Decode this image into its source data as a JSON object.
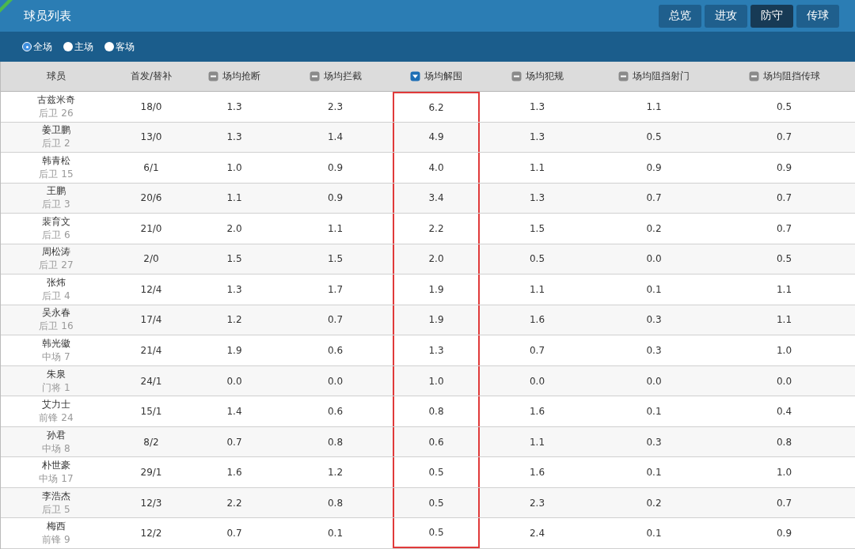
{
  "header": {
    "title": "球员列表",
    "tabs": [
      {
        "label": "总览",
        "selected": false
      },
      {
        "label": "进攻",
        "selected": false
      },
      {
        "label": "防守",
        "selected": true
      },
      {
        "label": "传球",
        "selected": false
      }
    ]
  },
  "filters": [
    {
      "label": "全场",
      "selected": true
    },
    {
      "label": "主场",
      "selected": false
    },
    {
      "label": "客场",
      "selected": false
    }
  ],
  "table": {
    "columns": [
      {
        "label": "球员",
        "kind": "plain",
        "highlighted": false
      },
      {
        "label": "首发/替补",
        "kind": "plain",
        "highlighted": false
      },
      {
        "label": "场均抢断",
        "kind": "sortable",
        "sorted": false,
        "highlighted": false
      },
      {
        "label": "场均拦截",
        "kind": "sortable",
        "sorted": false,
        "highlighted": false
      },
      {
        "label": "场均解围",
        "kind": "sortable",
        "sorted": true,
        "highlighted": true
      },
      {
        "label": "场均犯规",
        "kind": "sortable",
        "sorted": false,
        "highlighted": false
      },
      {
        "label": "场均阻挡射门",
        "kind": "sortable",
        "sorted": false,
        "highlighted": false
      },
      {
        "label": "场均阻挡传球",
        "kind": "sortable",
        "sorted": false,
        "highlighted": false
      }
    ],
    "rows": [
      {
        "cells": [
          "古兹米奇",
          "18/0",
          "1.3",
          "2.3",
          "6.2",
          "1.3",
          "1.1",
          "0.5"
        ],
        "position": "后卫 26"
      },
      {
        "cells": [
          "姜卫鹏",
          "13/0",
          "1.3",
          "1.4",
          "4.9",
          "1.3",
          "0.5",
          "0.7"
        ],
        "position": "后卫 2"
      },
      {
        "cells": [
          "韩青松",
          "6/1",
          "1.0",
          "0.9",
          "4.0",
          "1.1",
          "0.9",
          "0.9"
        ],
        "position": "后卫 15"
      },
      {
        "cells": [
          "王鹏",
          "20/6",
          "1.1",
          "0.9",
          "3.4",
          "1.3",
          "0.7",
          "0.7"
        ],
        "position": "后卫 3"
      },
      {
        "cells": [
          "裴育文",
          "21/0",
          "2.0",
          "1.1",
          "2.2",
          "1.5",
          "0.2",
          "0.7"
        ],
        "position": "后卫 6"
      },
      {
        "cells": [
          "周松涛",
          "2/0",
          "1.5",
          "1.5",
          "2.0",
          "0.5",
          "0.0",
          "0.5"
        ],
        "position": "后卫 27"
      },
      {
        "cells": [
          "张炜",
          "12/4",
          "1.3",
          "1.7",
          "1.9",
          "1.1",
          "0.1",
          "1.1"
        ],
        "position": "后卫 4"
      },
      {
        "cells": [
          "吴永春",
          "17/4",
          "1.2",
          "0.7",
          "1.9",
          "1.6",
          "0.3",
          "1.1"
        ],
        "position": "后卫 16"
      },
      {
        "cells": [
          "韩光徽",
          "21/4",
          "1.9",
          "0.6",
          "1.3",
          "0.7",
          "0.3",
          "1.0"
        ],
        "position": "中场 7"
      },
      {
        "cells": [
          "朱泉",
          "24/1",
          "0.0",
          "0.0",
          "1.0",
          "0.0",
          "0.0",
          "0.0"
        ],
        "position": "门将 1"
      },
      {
        "cells": [
          "艾力士",
          "15/1",
          "1.4",
          "0.6",
          "0.8",
          "1.6",
          "0.1",
          "0.4"
        ],
        "position": "前锋 24"
      },
      {
        "cells": [
          "孙君",
          "8/2",
          "0.7",
          "0.8",
          "0.6",
          "1.1",
          "0.3",
          "0.8"
        ],
        "position": "中场 8"
      },
      {
        "cells": [
          "朴世豪",
          "29/1",
          "1.6",
          "1.2",
          "0.5",
          "1.6",
          "0.1",
          "1.0"
        ],
        "position": "中场 17"
      },
      {
        "cells": [
          "李浩杰",
          "12/3",
          "2.2",
          "0.8",
          "0.5",
          "2.3",
          "0.2",
          "0.7"
        ],
        "position": "后卫 5"
      },
      {
        "cells": [
          "梅西",
          "12/2",
          "0.7",
          "0.1",
          "0.5",
          "2.4",
          "0.1",
          "0.9"
        ],
        "position": "前锋 9"
      }
    ]
  }
}
